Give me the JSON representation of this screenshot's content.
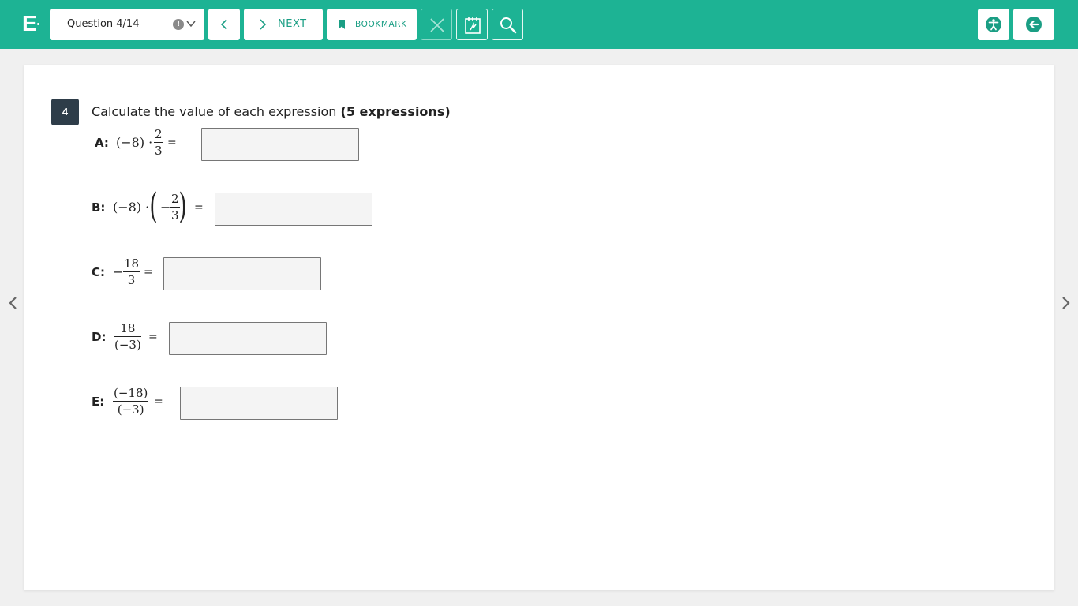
{
  "topbar": {
    "logo": "E",
    "question_selector": "Question 4/14",
    "warning_glyph": "!",
    "next_label": "NEXT",
    "bookmark_label": "BOOKMARK",
    "color": "#1db394",
    "accent": "#1a9e84"
  },
  "question": {
    "number": "4",
    "prompt_text": "Calculate the value of each expression ",
    "prompt_bold": "(5 expressions)",
    "items": [
      {
        "label": "A:",
        "expr_lead": "(−8) ·",
        "frac_num": "2",
        "frac_den": "3",
        "equals": "=",
        "answer": ""
      },
      {
        "label": "B:",
        "expr_lead": "(−8) ·",
        "inner_sign": "−",
        "frac_num": "2",
        "frac_den": "3",
        "paren_open": "(",
        "paren_close": ")",
        "equals": "=",
        "answer": ""
      },
      {
        "label": "C:",
        "expr_lead": "−",
        "frac_num": "18",
        "frac_den": "3",
        "equals": "=",
        "answer": ""
      },
      {
        "label": "D:",
        "frac_num": "18",
        "frac_den": "(−3)",
        "equals": "=",
        "answer": ""
      },
      {
        "label": "E:",
        "frac_num": "(−18)",
        "frac_den": "(−3)",
        "equals": "=",
        "answer": ""
      }
    ]
  }
}
